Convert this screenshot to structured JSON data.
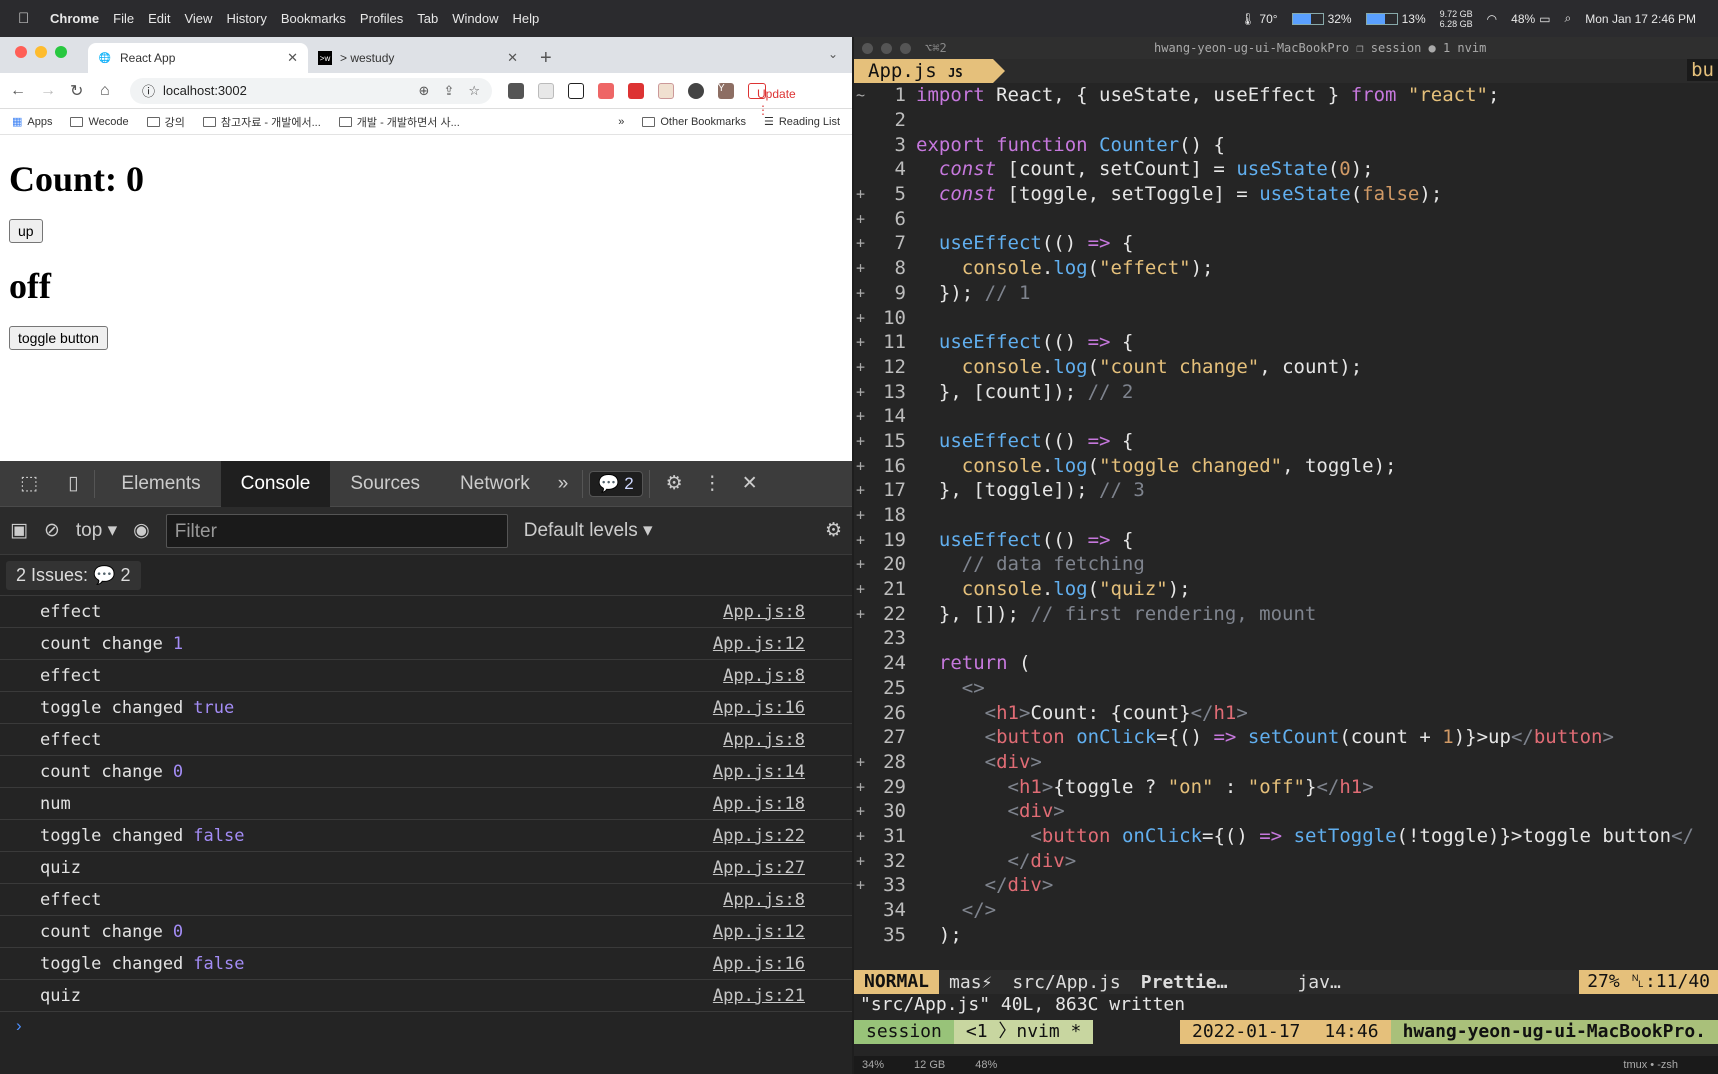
{
  "menubar": {
    "app": "Chrome",
    "items": [
      "File",
      "Edit",
      "View",
      "History",
      "Bookmarks",
      "Profiles",
      "Tab",
      "Window",
      "Help"
    ],
    "temp": "70°",
    "cpu": "32%",
    "mem": "13%",
    "storage": "9.72 GB",
    "storage2": "6.28 GB",
    "battery": "48%",
    "datetime": "Mon Jan 17  2:46 PM"
  },
  "chrome": {
    "tabs": [
      {
        "label": "React App"
      },
      {
        "label": "> westudy"
      }
    ],
    "url": "localhost:3002",
    "update_label": "Update",
    "bookmarks": [
      "Apps",
      "Wecode",
      "강의",
      "참고자료 - 개발에서...",
      "개발 - 개발하면서 사...",
      "Other Bookmarks",
      "Reading List"
    ]
  },
  "page": {
    "count_heading": "Count: 0",
    "up_button": "up",
    "toggle_heading": "off",
    "toggle_button": "toggle button"
  },
  "devtools": {
    "tabs": [
      "Elements",
      "Console",
      "Sources",
      "Network"
    ],
    "issue_count": "2",
    "context": "top",
    "filter_placeholder": "Filter",
    "levels": "Default levels",
    "issues_label": "2 Issues:",
    "issues_count": "2",
    "logs": [
      {
        "text": "effect",
        "value": "",
        "source": "App.js:8"
      },
      {
        "text": "count change",
        "value": "1",
        "source": "App.js:12"
      },
      {
        "text": "effect",
        "value": "",
        "source": "App.js:8"
      },
      {
        "text": "toggle changed",
        "value": "true",
        "source": "App.js:16"
      },
      {
        "text": "effect",
        "value": "",
        "source": "App.js:8"
      },
      {
        "text": "count change",
        "value": "0",
        "source": "App.js:14"
      },
      {
        "text": "num",
        "value": "",
        "source": "App.js:18"
      },
      {
        "text": "toggle changed",
        "value": "false",
        "source": "App.js:22"
      },
      {
        "text": "quiz",
        "value": "",
        "source": "App.js:27"
      },
      {
        "text": "effect",
        "value": "",
        "source": "App.js:8"
      },
      {
        "text": "count change",
        "value": "0",
        "source": "App.js:12"
      },
      {
        "text": "toggle changed",
        "value": "false",
        "source": "App.js:16"
      },
      {
        "text": "quiz",
        "value": "",
        "source": "App.js:21"
      }
    ]
  },
  "terminal": {
    "window_title": "hwang-yeon-ug-ui-MacBookPro ❐ session ● 1 nvim",
    "shortcut": "⌥⌘2",
    "buffer": "App.js",
    "buffer_badge": "JS",
    "buffer_right": "bu",
    "status": {
      "mode": "NORMAL",
      "branch": "mas⚡",
      "file": "src/App.js",
      "formatter": "Prettie…",
      "lang": "jav…",
      "position": "27% ␤:11/40"
    },
    "message": "\"src/App.js\" 40L, 863C written",
    "tmux": {
      "session": "session",
      "window": "<1 〉nvim *",
      "date": "2022-01-17",
      "time": "14:46",
      "host": "hwang-yeon-ug-ui-MacBookPro."
    },
    "bottom": [
      "34%",
      "12 GB",
      "48%",
      "tmux • -zsh"
    ]
  }
}
